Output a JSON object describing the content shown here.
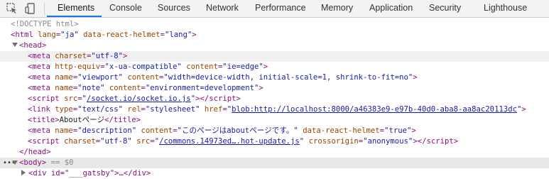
{
  "toolbar": {
    "tabs": [
      "Elements",
      "Console",
      "Sources",
      "Network",
      "Performance",
      "Memory",
      "Application",
      "Security",
      "Lighthouse"
    ],
    "active_tab": "Elements"
  },
  "dom": {
    "doctype": "<!DOCTYPE html>",
    "html_tag": "html",
    "html_attrs": [
      {
        "name": "lang",
        "value": "\"ja\""
      },
      {
        "name": "data-react-helmet",
        "value": "\"lang\""
      }
    ],
    "head_tag": "head",
    "meta1": {
      "tag": "meta",
      "attrs": [
        {
          "name": "charset",
          "value": "\"utf-8\""
        }
      ]
    },
    "meta2": {
      "tag": "meta",
      "attrs": [
        {
          "name": "http-equiv",
          "value": "\"x-ua-compatible\""
        },
        {
          "name": "content",
          "value": "\"ie=edge\""
        }
      ]
    },
    "meta3": {
      "tag": "meta",
      "attrs": [
        {
          "name": "name",
          "value": "\"viewport\""
        },
        {
          "name": "content",
          "value": "\"width=device-width, initial-scale=1, shrink-to-fit=no\""
        }
      ]
    },
    "meta4": {
      "tag": "meta",
      "attrs": [
        {
          "name": "name",
          "value": "\"note\""
        },
        {
          "name": "content",
          "value": "\"environment=development\""
        }
      ]
    },
    "script1": {
      "tag": "script",
      "attr": "src",
      "link": "/socket.io/socket.io.js",
      "close": "script"
    },
    "link1": {
      "tag": "link",
      "attrs": [
        {
          "name": "type",
          "value": "\"text/css\""
        },
        {
          "name": "rel",
          "value": "\"stylesheet\""
        }
      ],
      "href_attr": "href",
      "href": "blob:http://localhost:8000/a46383e9-e97b-40d0-aba8-aa8ac20113dc"
    },
    "title1": {
      "tag": "title",
      "text": "Aboutページ",
      "close": "title"
    },
    "meta5": {
      "tag": "meta",
      "attrs": [
        {
          "name": "name",
          "value": "\"description\""
        },
        {
          "name": "content",
          "value": "\"このページはaboutページです。\""
        },
        {
          "name": "data-react-helmet",
          "value": "\"true\""
        }
      ]
    },
    "script2": {
      "tag": "script",
      "attr1": "charset",
      "val1": "\"utf-8\"",
      "attr2": "src",
      "link": "/commons.14973ed….hot-update.js",
      "attr3": "crossorigin",
      "val3": "\"anonymous\"",
      "close": "script"
    },
    "head_close": "head",
    "body_tag": "body",
    "body_suffix": " == $0",
    "next_row": "<div id=\"___gatsby\">…</div>"
  },
  "colors": {
    "tag": "#881280",
    "attr_name": "#994500",
    "attr_value": "#1a1aa6",
    "accent": "#1a73e8"
  }
}
